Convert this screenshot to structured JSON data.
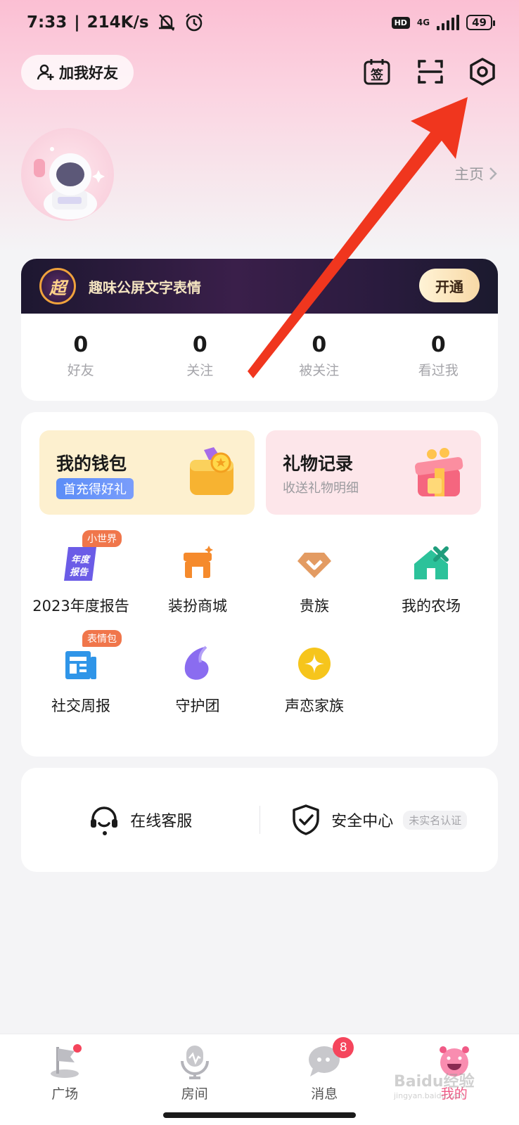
{
  "status_bar": {
    "time": "7:33",
    "speed": "214K/s",
    "network": "4G",
    "battery": "49",
    "hd": "HD"
  },
  "header": {
    "add_friend_label": "加我好友",
    "checkin_glyph": "签"
  },
  "profile": {
    "home_link": "主页"
  },
  "vip_banner": {
    "badge_text": "超",
    "text": "趣味公屏文字表情",
    "button": "开通"
  },
  "stats": [
    {
      "value": "0",
      "label": "好友"
    },
    {
      "value": "0",
      "label": "关注"
    },
    {
      "value": "0",
      "label": "被关注"
    },
    {
      "value": "0",
      "label": "看过我"
    }
  ],
  "wallet": {
    "title": "我的钱包",
    "subtitle": "首充得好礼"
  },
  "gift_record": {
    "title": "礼物记录",
    "subtitle": "收送礼物明细"
  },
  "grid": [
    {
      "label": "2023年度报告",
      "tag": "小世界",
      "icon_text": "年度报告"
    },
    {
      "label": "装扮商城",
      "tag": ""
    },
    {
      "label": "贵族",
      "tag": ""
    },
    {
      "label": "我的农场",
      "tag": ""
    },
    {
      "label": "社交周报",
      "tag": "表情包"
    },
    {
      "label": "守护团",
      "tag": ""
    },
    {
      "label": "声恋家族",
      "tag": ""
    }
  ],
  "service": {
    "online_support": "在线客服",
    "security_center": "安全中心",
    "security_tag": "未实名认证"
  },
  "bottom_nav": [
    {
      "label": "广场"
    },
    {
      "label": "房间"
    },
    {
      "label": "消息",
      "badge": "8"
    },
    {
      "label": "我的"
    }
  ],
  "watermark": {
    "text": "Baidu经验",
    "sub": "jingyan.baidu.com"
  },
  "colors": {
    "accent_pink": "#f05a86",
    "arrow_red": "#f0361e",
    "badge_red": "#f5455c"
  }
}
